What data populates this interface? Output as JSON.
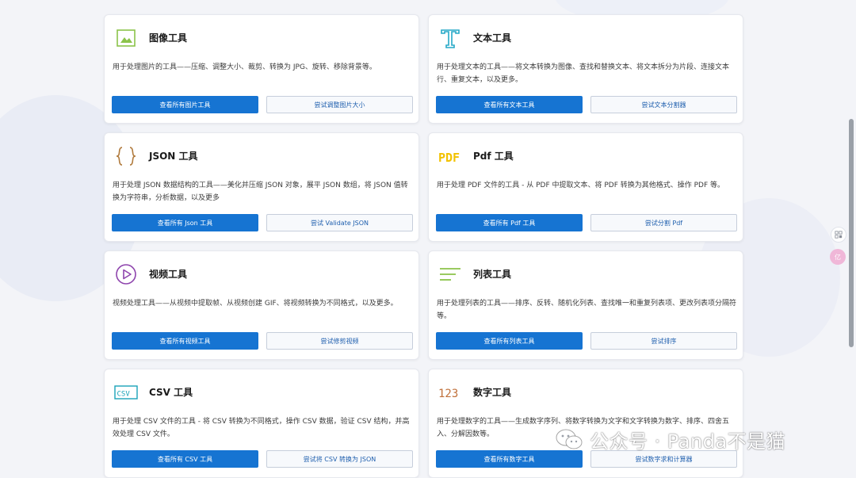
{
  "colors": {
    "primary_button": "#1674d2",
    "secondary_border": "#c6cedb",
    "page_background": "#f3f4f8"
  },
  "cards": [
    {
      "icon": "image-icon",
      "title": "图像工具",
      "desc": "用于处理图片的工具——压缩、调整大小、裁剪、转换为 JPG、旋转、移除背景等。",
      "primary_label": "查看所有图片工具",
      "secondary_label": "尝试调整图片大小"
    },
    {
      "icon": "text-icon",
      "title": "文本工具",
      "desc": "用于处理文本的工具——将文本转换为图像、查找和替换文本、将文本拆分为片段、连接文本行、重复文本，以及更多。",
      "primary_label": "查看所有文本工具",
      "secondary_label": "尝试文本分割器"
    },
    {
      "icon": "json-braces-icon",
      "title": "JSON 工具",
      "desc": "用于处理 JSON 数据结构的工具——美化并压缩 JSON 对象，展平 JSON 数组，将 JSON 值转换为字符串，分析数据，以及更多",
      "primary_label": "查看所有 Json 工具",
      "secondary_label": "尝试 Validate JSON"
    },
    {
      "icon": "pdf-icon",
      "icon_text": "PDF",
      "title": "Pdf 工具",
      "desc": "用于处理 PDF 文件的工具 - 从 PDF 中提取文本、将 PDF 转换为其他格式、操作 PDF 等。",
      "primary_label": "查看所有 Pdf 工具",
      "secondary_label": "尝试分割 Pdf"
    },
    {
      "icon": "video-play-icon",
      "title": "视频工具",
      "desc": "视频处理工具——从视频中提取帧、从视频创建 GIF、将视频转换为不同格式，以及更多。",
      "primary_label": "查看所有视频工具",
      "secondary_label": "尝试修剪视频"
    },
    {
      "icon": "list-icon",
      "title": "列表工具",
      "desc": "用于处理列表的工具——排序、反转、随机化列表、查找唯一和重复列表项、更改列表项分隔符等。",
      "primary_label": "查看所有列表工具",
      "secondary_label": "尝试排序"
    },
    {
      "icon": "csv-icon",
      "icon_text": "CSV",
      "title": "CSV 工具",
      "desc": "用于处理 CSV 文件的工具 - 将 CSV 转换为不同格式，操作 CSV 数据，验证 CSV 结构，并高效处理 CSV 文件。",
      "primary_label": "查看所有 CSV 工具",
      "secondary_label": "尝试将 CSV 转换为 JSON"
    },
    {
      "icon": "number-icon",
      "icon_text": "123",
      "title": "数字工具",
      "desc": "用于处理数字的工具——生成数字序列、将数字转换为文字和文字转换为数字、排序、四舍五入、分解因数等。",
      "primary_label": "查看所有数字工具",
      "secondary_label": "尝试数字求和计算器"
    }
  ],
  "side": {
    "grid_icon": "qr-grid-icon",
    "avatar_icon": "avatar-icon",
    "avatar_text": "亿"
  },
  "watermark": {
    "icon": "wechat-icon",
    "text": "公众号 · Panda不是猫"
  }
}
